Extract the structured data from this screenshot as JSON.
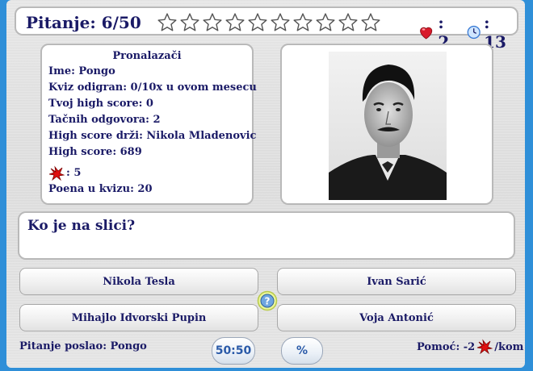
{
  "topbar": {
    "question_label": "Pitanje: 6/50",
    "stars_total": 10,
    "stars_filled": 0,
    "lives_value": ": 2",
    "timer_value": ": 13",
    "icons": {
      "star": "star-outline-icon",
      "heart": "heart-icon",
      "clock": "clock-icon"
    }
  },
  "info": {
    "title": "Pronalazači",
    "lines": [
      "Ime: Pongo",
      "Kviz odigran: 0/10x u ovom mesecu",
      "Tvoj high score: 0",
      "Tačnih odgovora: 2",
      "High score drži: Nikola Mladenovic",
      "High score: 689"
    ],
    "red_count": ": 5",
    "points": "Poena u kvizu: 20"
  },
  "question": {
    "text": "Ko je na slici?"
  },
  "answers": [
    "Nikola Tesla",
    "Ivan Sarić",
    "Mihajlo Idvorski Pupin",
    "Voja Antonić"
  ],
  "footer": {
    "sent_by": "Pitanje poslao: Pongo",
    "fifty_label": "50:50",
    "percent_label": "%",
    "help_prefix": "Pomoć: -2",
    "help_suffix": "/kom"
  },
  "colors": {
    "background": "#2f8fd8",
    "text": "#1a1a66",
    "heart": "#d81b2b",
    "red_mark": "#e01010"
  }
}
